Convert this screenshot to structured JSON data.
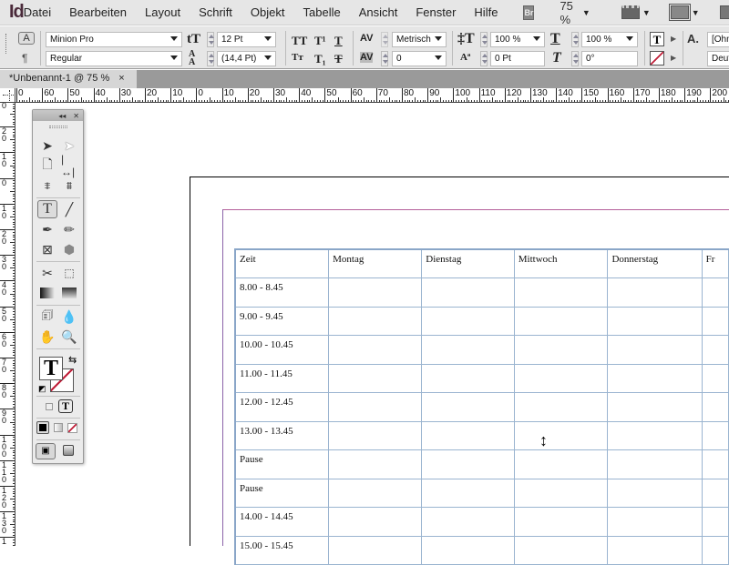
{
  "app": {
    "logo": "Id"
  },
  "menu": {
    "items": [
      "Datei",
      "Bearbeiten",
      "Layout",
      "Schrift",
      "Objekt",
      "Tabelle",
      "Ansicht",
      "Fenster",
      "Hilfe"
    ],
    "bridge_label": "Br",
    "zoom": "75 %"
  },
  "control": {
    "font_family": "Minion Pro",
    "font_style": "Regular",
    "font_size": "12 Pt",
    "leading": "(14,4 Pt)",
    "kerning": "Metrisch",
    "tracking": "0",
    "vertical_scale": "100 %",
    "baseline_shift": "0 Pt",
    "horizontal_scale": "100 %",
    "skew": "0°",
    "char_style": "[Ohn",
    "language": "Deut"
  },
  "document": {
    "tab_title": "*Unbenannt-1 @ 75 %",
    "close": "×"
  },
  "ruler": {
    "h_labels": [
      "0",
      "60",
      "50",
      "40",
      "30",
      "20",
      "10",
      "0",
      "10",
      "20",
      "30",
      "40",
      "50",
      "60",
      "70",
      "80",
      "90",
      "100",
      "110",
      "120",
      "130",
      "140",
      "150",
      "160",
      "170",
      "180",
      "190",
      "200"
    ],
    "v_labels": [
      "0",
      "20",
      "10",
      "0",
      "10",
      "20",
      "30",
      "40",
      "50",
      "60",
      "70",
      "80",
      "90",
      "100",
      "110",
      "120",
      "130",
      "1"
    ]
  },
  "table": {
    "headers": [
      "Zeit",
      "Montag",
      "Dienstag",
      "Mittwoch",
      "Donnerstag",
      "Fr"
    ],
    "rows": [
      "8.00 - 8.45",
      "9.00 - 9.45",
      "10.00 - 10.45",
      "11.00 - 11.45",
      "12.00 - 12.45",
      "13.00 - 13.45",
      "Pause",
      "Pause",
      "14.00 - 14.45",
      "15.00 - 15.45"
    ]
  },
  "colors": {
    "margin_guide": "#b4609a",
    "table_border": "#9ab4d0",
    "none_swatch": "#c0203a"
  }
}
